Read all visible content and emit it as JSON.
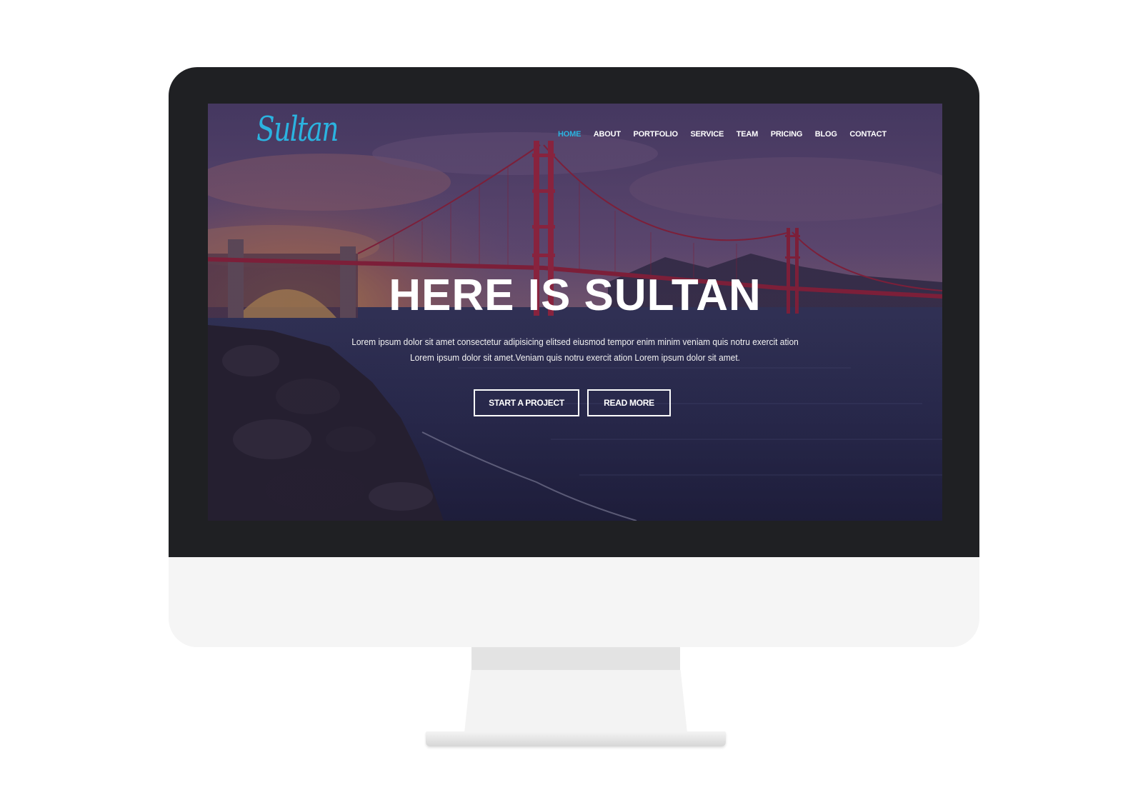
{
  "site": {
    "logo_text": "Sultan",
    "accent_color": "#2bb3e0"
  },
  "nav": {
    "items": [
      {
        "label": "HOME",
        "active": true
      },
      {
        "label": "ABOUT",
        "active": false
      },
      {
        "label": "PORTFOLIO",
        "active": false
      },
      {
        "label": "SERVICE",
        "active": false
      },
      {
        "label": "TEAM",
        "active": false
      },
      {
        "label": "PRICING",
        "active": false
      },
      {
        "label": "BLOG",
        "active": false
      },
      {
        "label": "CONTACT",
        "active": false
      }
    ]
  },
  "hero": {
    "title": "HERE IS SULTAN",
    "description_line1": "Lorem ipsum dolor sit amet consectetur adipisicing elitsed eiusmod tempor enim minim veniam quis notru exercit ation",
    "description_line2": "Lorem ipsum dolor sit amet.Veniam quis notru exercit ation Lorem ipsum dolor sit amet.",
    "primary_button": "START A PROJECT",
    "secondary_button": "READ MORE"
  },
  "device": {
    "bezel_color": "#1f2023",
    "chin_color": "#f5f5f5"
  }
}
